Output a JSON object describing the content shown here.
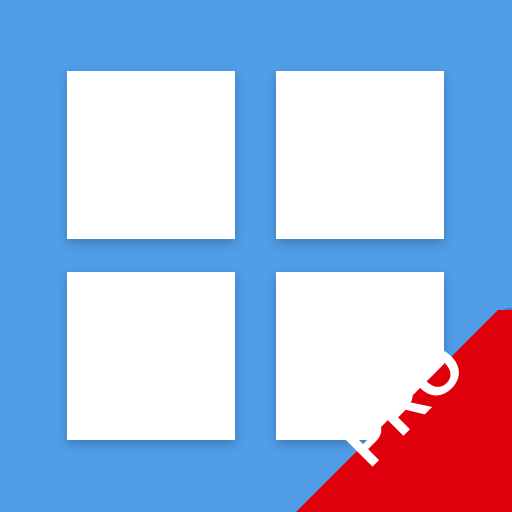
{
  "icon": {
    "background_color": "#509de8",
    "tile_color": "#ffffff",
    "tiles": [
      "tile",
      "tile",
      "tile",
      "tile"
    ]
  },
  "ribbon": {
    "label": "PRO",
    "color": "#e0000b",
    "text_color": "#ffffff"
  }
}
